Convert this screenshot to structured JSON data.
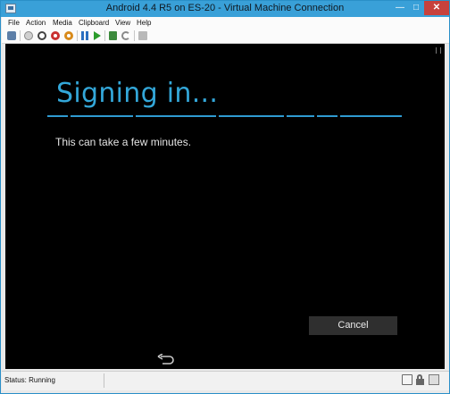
{
  "window": {
    "title": "Android 4.4 R5 on ES-20 - Virtual Machine Connection",
    "buttons": {
      "minimize": "—",
      "maximize": "□",
      "close": "✕"
    }
  },
  "menu": [
    "File",
    "Action",
    "Media",
    "Clipboard",
    "View",
    "Help"
  ],
  "toolbar": {
    "icons": [
      "ctrl-alt-del-icon",
      "start-icon",
      "turn-off-icon",
      "shut-down-icon",
      "save-state-icon",
      "pause-icon",
      "resume-icon",
      "checkpoint-icon",
      "revert-icon",
      "enhanced-session-icon"
    ]
  },
  "screen": {
    "heading": "Signing in...",
    "message": "This can take a few minutes.",
    "cancel_label": "Cancel",
    "accent_color": "#33a7d9"
  },
  "statusbar": {
    "status": "Status: Running"
  }
}
